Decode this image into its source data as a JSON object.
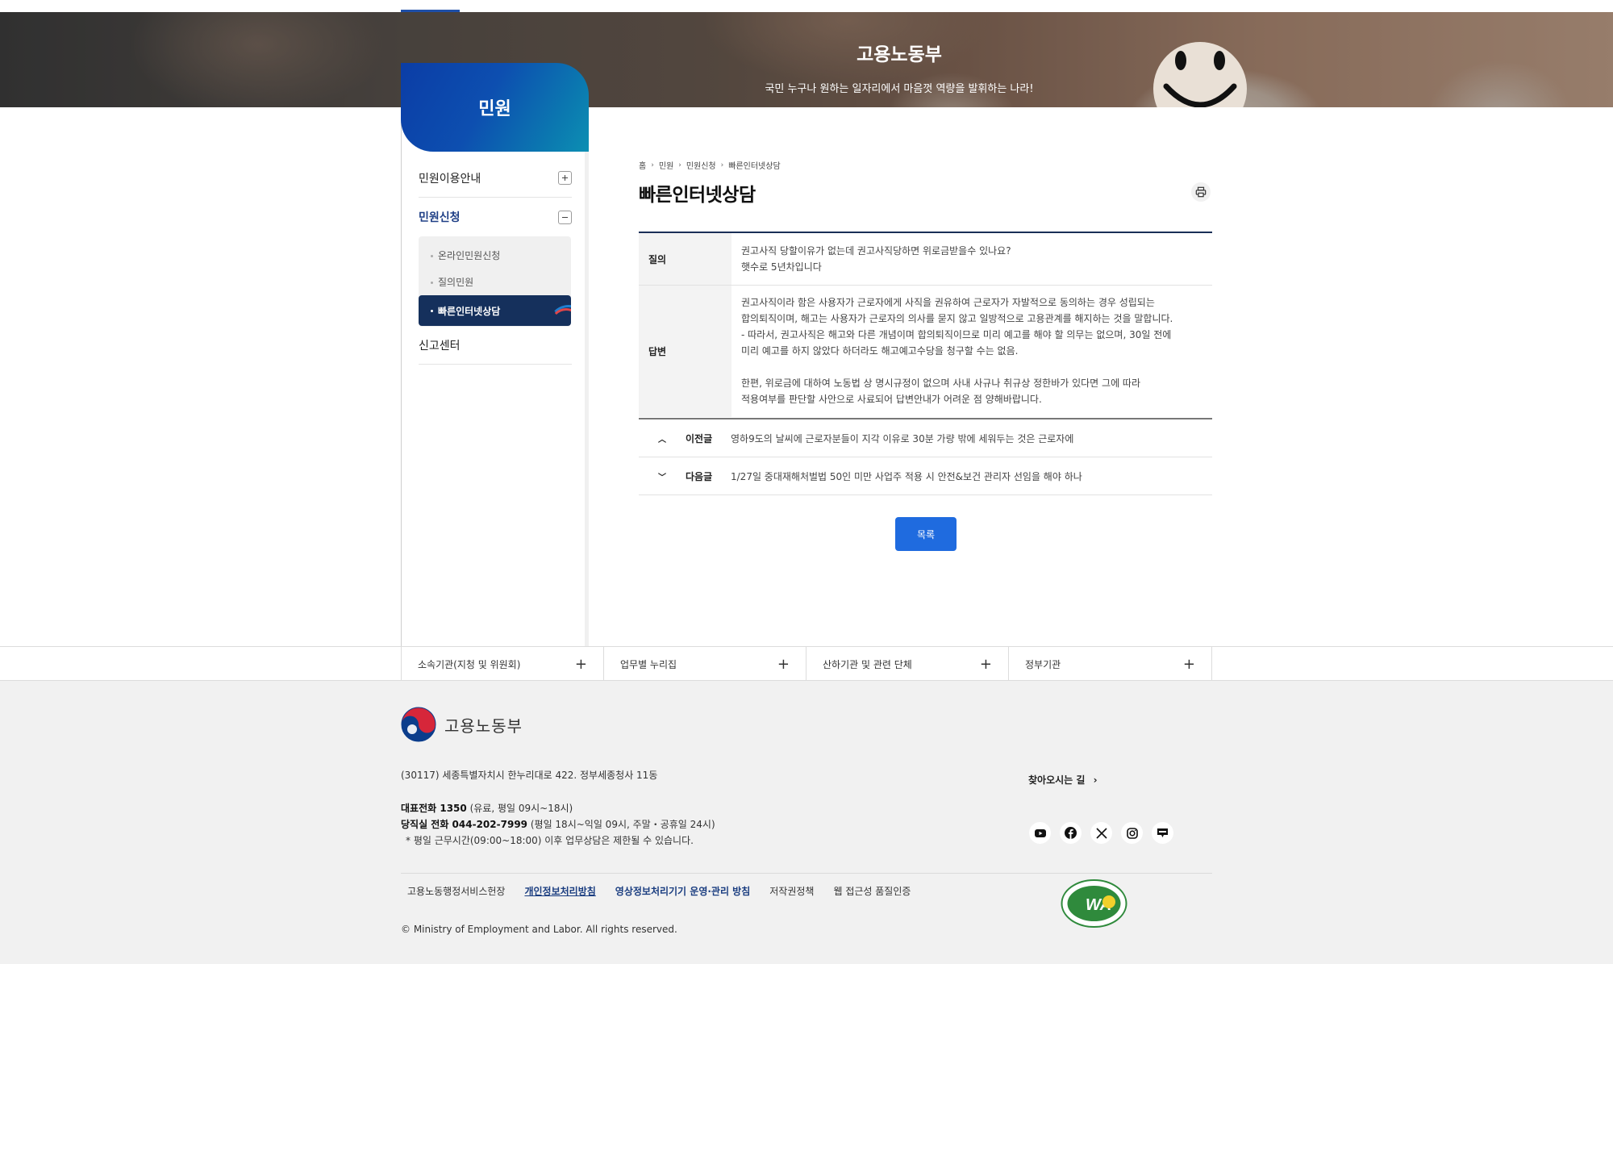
{
  "banner": {
    "title": "고용노동부",
    "subtitle": "국민 누구나 원하는 일자리에서 마음껏 역량을 발휘하는 나라!"
  },
  "sidebar": {
    "heading": "민원",
    "items": [
      {
        "label": "민원이용안내",
        "state": "collapsed"
      },
      {
        "label": "민원신청",
        "state": "expanded"
      }
    ],
    "sub_items": [
      {
        "label": "온라인민원신청"
      },
      {
        "label": "질의민원"
      },
      {
        "label": "빠른인터넷상담",
        "active": true
      }
    ],
    "report": "신고센터"
  },
  "breadcrumb": [
    "홈",
    "민원",
    "민원신청",
    "빠른인터넷상담"
  ],
  "page_title": "빠른인터넷상담",
  "qa": {
    "question_label": "질의",
    "question": [
      "권고사직 당할이유가 없는데 권고사직당하면 위로금받을수 있나요?",
      "햇수로 5년차입니다"
    ],
    "answer_label": "답변",
    "answer": [
      "권고사직이라 함은 사용자가 근로자에게 사직을 권유하여 근로자가 자발적으로 동의하는 경우 성립되는",
      "합의퇴직이며, 해고는 사용자가 근로자의 의사를 묻지 않고 일방적으로 고용관계를 해지하는 것을 말합니다.",
      "- 따라서, 권고사직은 해고와 다른 개념이며 합의퇴직이므로 미리 예고를 해야 할 의무는 없으며, 30일 전에",
      "미리 예고를 하지 않았다 하더라도 해고예고수당을 청구할 수는 없음.",
      "",
      "한편, 위로금에 대하여 노동법 상 명시규정이 없으며 사내 사규나 취규상 정한바가 있다면 그에 따라",
      "적용여부를 판단할 사안으로 사료되어 답변안내가 어려운 점 양해바랍니다."
    ]
  },
  "posts": {
    "prev_label": "이전글",
    "prev_title": "영하9도의 날씨에 근로자분들이 지각 이유로 30분 가량 밖에 세워두는 것은 근로자에",
    "next_label": "다음글",
    "next_title": "1/27일 중대재해처벌법 50인 미만 사업주 적용 시 안전&보건 관리자 선임을 해야 하나"
  },
  "list_button": "목록",
  "related": [
    {
      "label": "소속기관(지청 및 위원회)"
    },
    {
      "label": "업무별 누리집"
    },
    {
      "label": "산하기관 및 관련 단체"
    },
    {
      "label": "정부기관"
    }
  ],
  "footer": {
    "logo_text": "고용노동부",
    "address": "(30117) 세종특별자치시 한누리대로 422. 정부세종청사 11동",
    "tel_label": "대표전화 1350",
    "tel_note": "(유료, 평일 09시~18시)",
    "night_label": "당직실 전화 044-202-7999",
    "night_note": "(평일 18시~익일 09시, 주말・공휴일 24시)",
    "notice": "* 평일 근무시간(09:00~18:00) 이후 업무상담은 제한될 수 있습니다.",
    "directions": "찾아오시는 길",
    "social_icons": [
      "youtube-icon",
      "facebook-icon",
      "x-icon",
      "instagram-icon",
      "blog-icon"
    ],
    "links": [
      "고용노동행정서비스헌장",
      "개인정보처리방침",
      "영상정보처리기기 운영·관리 방침",
      "저작권정책",
      "웹 접근성 품질인증"
    ],
    "copyright": "© Ministry of Employment and Labor. All rights reserved.",
    "wa_mark": "WA"
  },
  "colors": {
    "accent": "#1f6bdf",
    "nav_active": "#15305c",
    "header_gradient_start": "#0b3da6",
    "header_gradient_end": "#0c8fb3"
  }
}
